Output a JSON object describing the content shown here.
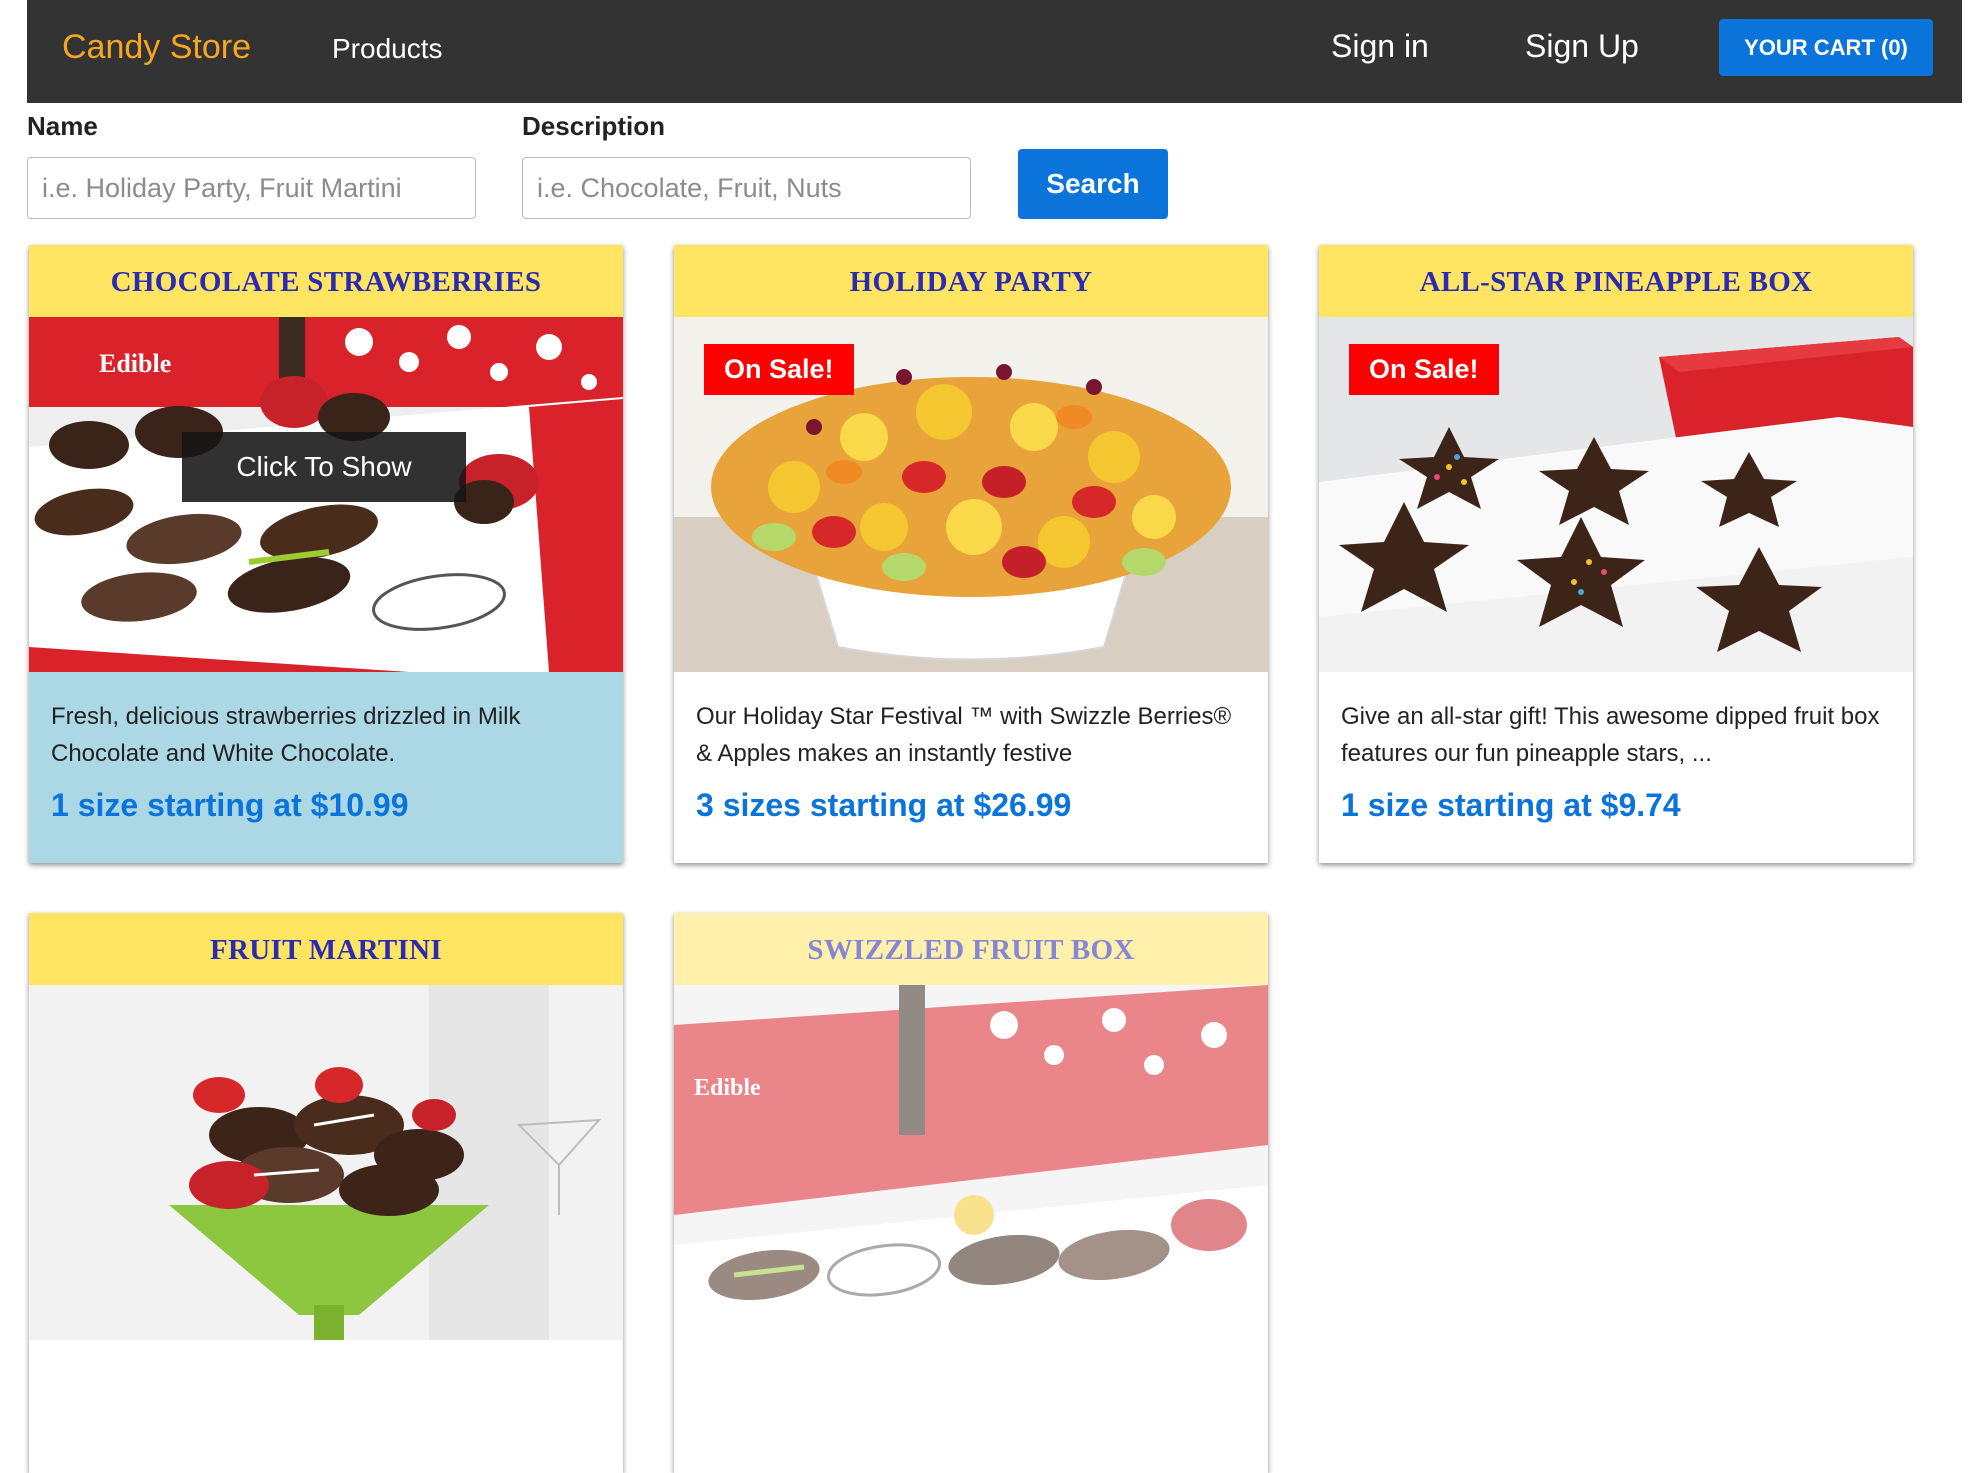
{
  "nav": {
    "brand": "Candy Store",
    "products": "Products",
    "sign_in": "Sign in",
    "sign_up": "Sign Up",
    "cart": "Your Cart (0)"
  },
  "filters": {
    "name_label": "Name",
    "name_placeholder": "i.e. Holiday Party, Fruit Martini",
    "desc_label": "Description",
    "desc_placeholder": "i.e. Chocolate, Fruit, Nuts",
    "search_button": "Search"
  },
  "products": [
    {
      "title": "Chocolate Strawberries",
      "description": "Fresh, delicious strawberries drizzled in Milk Chocolate and White Chocolate.",
      "price": "1 size starting at $10.99",
      "overlay": "Click To Show",
      "image_icon": "chocolate-strawberries-image"
    },
    {
      "title": "Holiday Party",
      "description": "Our Holiday Star Festival ™ with Swizzle Berries® & Apples makes an instantly festive",
      "price": "3 sizes starting at $26.99",
      "badge": "On Sale!",
      "image_icon": "fruit-bouquet-image"
    },
    {
      "title": "All-Star Pineapple Box",
      "description": "Give an all-star gift! This awesome dipped fruit box features our fun pineapple stars, ...",
      "price": "1 size starting at $9.74",
      "badge": "On Sale!",
      "image_icon": "chocolate-stars-image"
    },
    {
      "title": "Fruit Martini",
      "image_icon": "fruit-martini-image"
    },
    {
      "title": "Swizzled Fruit Box",
      "image_icon": "swizzled-fruit-box-image"
    }
  ],
  "colors": {
    "navbar": "#333333",
    "brand": "#f5a623",
    "primary": "#0a74da",
    "card_header": "#ffe561",
    "card_title": "#2a2ab2",
    "hover_body": "#acd8e6",
    "sale_badge": "#ff0000"
  }
}
